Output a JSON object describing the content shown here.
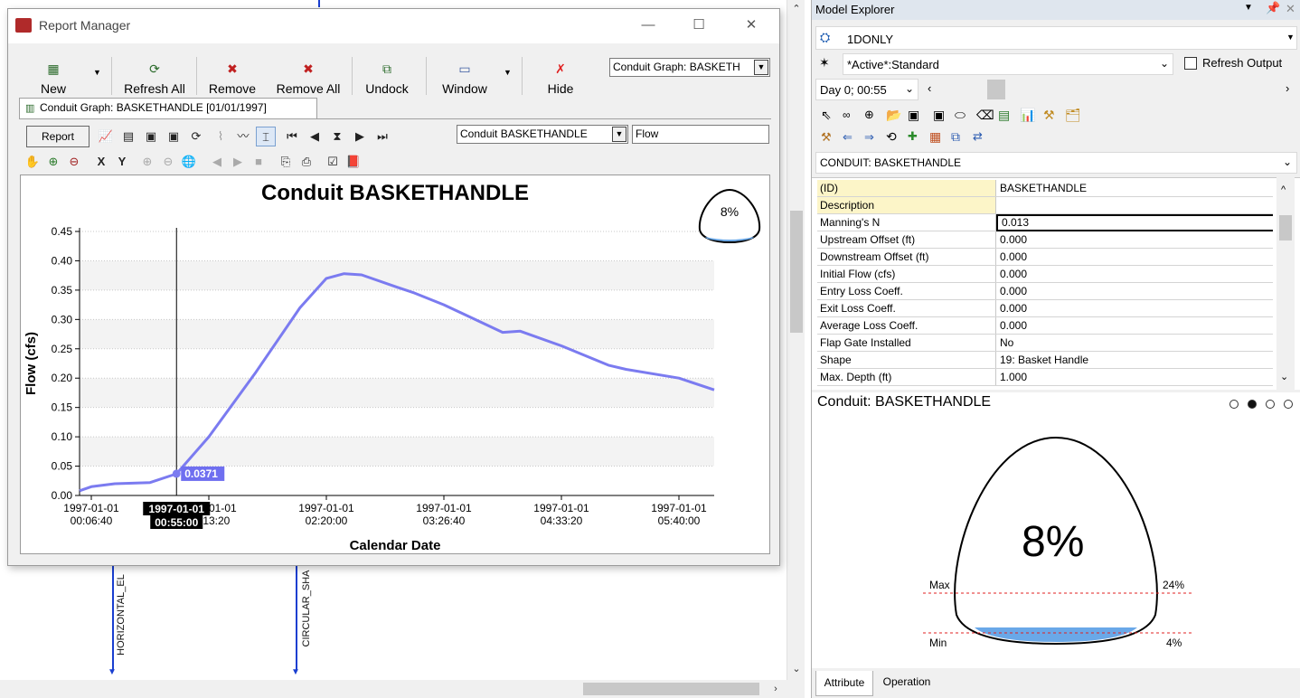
{
  "report_manager": {
    "title": "Report Manager",
    "toolbar": {
      "new": "New",
      "refresh_all": "Refresh All",
      "remove": "Remove",
      "remove_all": "Remove All",
      "undock": "Undock",
      "window": "Window",
      "hide": "Hide",
      "report_select": "Conduit Graph: BASKETH"
    },
    "tab_label": "Conduit Graph: BASKETHANDLE [01/01/1997]",
    "report_button": "Report",
    "object_select": "Conduit BASKETHANDLE",
    "variable_field": "Flow",
    "fill_indicator": "8%"
  },
  "chart_data": {
    "type": "line",
    "title": "Conduit BASKETHANDLE",
    "xlabel": "Calendar Date",
    "ylabel": "Flow (cfs)",
    "ylim": [
      0,
      0.45
    ],
    "yticks": [
      "0.00",
      "0.05",
      "0.10",
      "0.15",
      "0.20",
      "0.25",
      "0.30",
      "0.35",
      "0.40",
      "0.45"
    ],
    "xticks": [
      {
        "date": "1997-01-01",
        "time": "00:06:40"
      },
      {
        "date": "1997-01-01",
        "time": "01:13:20"
      },
      {
        "date": "1997-01-01",
        "time": "02:20:00"
      },
      {
        "date": "1997-01-01",
        "time": "03:26:40"
      },
      {
        "date": "1997-01-01",
        "time": "04:33:20"
      },
      {
        "date": "1997-01-01",
        "time": "05:40:00"
      }
    ],
    "series": [
      {
        "color": "#7b7bf0",
        "x": [
          "00:00",
          "00:06:40",
          "00:20",
          "00:40",
          "00:55",
          "01:13:20",
          "01:40",
          "02:05",
          "02:20:00",
          "02:30",
          "02:40",
          "03:00",
          "03:10",
          "03:26:40",
          "04:00",
          "04:10",
          "04:33:20",
          "05:00",
          "05:10",
          "05:40:00",
          "06:00"
        ],
        "y": [
          0.008,
          0.015,
          0.02,
          0.022,
          0.037,
          0.1,
          0.21,
          0.32,
          0.37,
          0.378,
          0.376,
          0.355,
          0.345,
          0.325,
          0.278,
          0.28,
          0.255,
          0.222,
          0.215,
          0.2,
          0.18
        ]
      }
    ],
    "cursor": {
      "date": "1997-01-01",
      "time": "00:55:00",
      "value": "0.0371"
    },
    "grid": "horizontal bands",
    "legend": "none"
  },
  "map_labels": {
    "left_conduit": "HORIZONTAL_EL",
    "right_conduit": "CIRCULAR_SHA"
  },
  "model_explorer": {
    "title": "Model Explorer",
    "model_name": "1DONLY",
    "scenario": "*Active*:Standard",
    "refresh_output": "Refresh Output",
    "time_select": "Day 0;  00:55",
    "object_select": "CONDUIT: BASKETHANDLE",
    "properties": [
      {
        "key": "(ID)",
        "value": "BASKETHANDLE"
      },
      {
        "key": "Description",
        "value": ""
      },
      {
        "key": "Manning's N",
        "value": "0.013"
      },
      {
        "key": "Upstream Offset (ft)",
        "value": "0.000"
      },
      {
        "key": "Downstream Offset (ft)",
        "value": "0.000"
      },
      {
        "key": "Initial Flow (cfs)",
        "value": "0.000"
      },
      {
        "key": "Entry Loss Coeff.",
        "value": "0.000"
      },
      {
        "key": "Exit Loss Coeff.",
        "value": "0.000"
      },
      {
        "key": "Average Loss Coeff.",
        "value": "0.000"
      },
      {
        "key": "Flap Gate Installed",
        "value": "No"
      },
      {
        "key": "Shape",
        "value": "19: Basket Handle"
      },
      {
        "key": "Max. Depth (ft)",
        "value": "1.000"
      }
    ],
    "section_title": "Conduit: BASKETHANDLE",
    "fill_percent": "8%",
    "fill_fraction": 0.08,
    "max_label": "Max",
    "max_value": "24%",
    "min_label": "Min",
    "min_value": "4%",
    "tabs": [
      "Attribute",
      "Operation"
    ],
    "colors": {
      "fill": "#6aa8e8",
      "limit_line": "#e02020",
      "series": "#7b7bf0"
    }
  }
}
